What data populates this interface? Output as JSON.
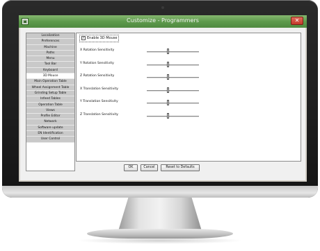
{
  "window": {
    "title": "Customize - Programmers",
    "close_glyph": "✕"
  },
  "nav": {
    "items": [
      {
        "label": "Localization"
      },
      {
        "label": "Preferences"
      },
      {
        "label": "Machine"
      },
      {
        "label": "Paths"
      },
      {
        "label": "Menu"
      },
      {
        "label": "Tool Bar"
      },
      {
        "label": "Keyboard"
      },
      {
        "label": "3D Mouse",
        "selected": true
      },
      {
        "label": "Main Operation Table"
      },
      {
        "label": "Wheel Assignment Table"
      },
      {
        "label": "Grinding Setup Table"
      },
      {
        "label": "Infeed Tables"
      },
      {
        "label": "Operation Table"
      },
      {
        "label": "Views"
      },
      {
        "label": "Profile Editor"
      },
      {
        "label": "Network"
      },
      {
        "label": "Software update"
      },
      {
        "label": "EN Identification"
      },
      {
        "label": "User Control"
      }
    ]
  },
  "panel": {
    "enable_label": "Enable 3D Mouse",
    "enable_checked": true,
    "sliders": [
      {
        "label": "X Rotation Sensitivity",
        "value": 0.4
      },
      {
        "label": "Y Rotation Sensitivity",
        "value": 0.4
      },
      {
        "label": "Z Rotation Sensitivity",
        "value": 0.4
      },
      {
        "label": "X Translation Sensitivity",
        "value": 0.4
      },
      {
        "label": "Y Translation Sensitivity",
        "value": 0.4
      },
      {
        "label": "Z Translation Sensitivity",
        "value": 0.4
      }
    ]
  },
  "buttons": {
    "ok": "OK",
    "cancel": "Cancel",
    "reset": "Reset to Defaults"
  },
  "colors": {
    "titlebar": "#5e9a4c",
    "close": "#c23a2a",
    "nav_item": "#c9c9c9"
  }
}
